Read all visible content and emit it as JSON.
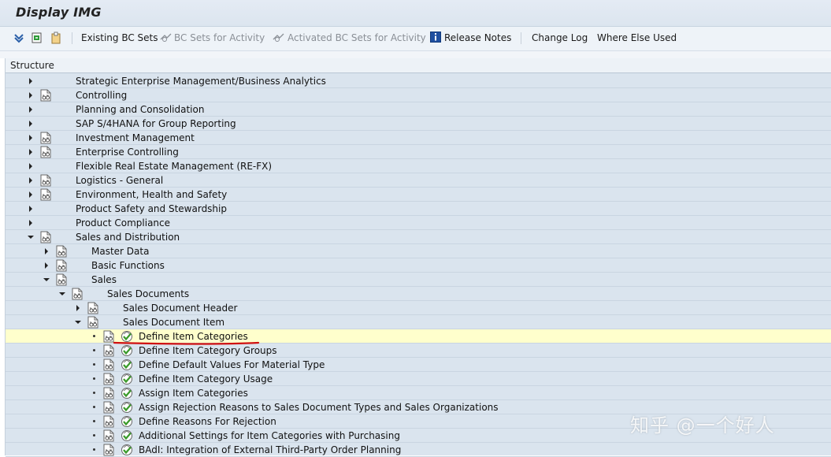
{
  "window": {
    "title": "Display IMG"
  },
  "toolbar": {
    "existing_bc_sets": "Existing BC Sets",
    "bc_sets_for_activity": "BC Sets for Activity",
    "activated_bc_sets": "Activated BC Sets for Activity",
    "release_notes": "Release Notes",
    "change_log": "Change Log",
    "where_else_used": "Where Else Used"
  },
  "tree": {
    "header": "Structure",
    "rows": [
      {
        "label": "Strategic Enterprise Management/Business Analytics",
        "level": 0,
        "state": "collapsed",
        "doc": false
      },
      {
        "label": "Controlling",
        "level": 0,
        "state": "collapsed",
        "doc": true
      },
      {
        "label": "Planning and Consolidation",
        "level": 0,
        "state": "collapsed",
        "doc": false
      },
      {
        "label": "SAP S/4HANA for Group Reporting",
        "level": 0,
        "state": "collapsed",
        "doc": false
      },
      {
        "label": "Investment Management",
        "level": 0,
        "state": "collapsed",
        "doc": true
      },
      {
        "label": "Enterprise Controlling",
        "level": 0,
        "state": "collapsed",
        "doc": true
      },
      {
        "label": "Flexible Real Estate Management (RE-FX)",
        "level": 0,
        "state": "collapsed",
        "doc": false
      },
      {
        "label": "Logistics - General",
        "level": 0,
        "state": "collapsed",
        "doc": true
      },
      {
        "label": "Environment, Health and Safety",
        "level": 0,
        "state": "collapsed",
        "doc": true
      },
      {
        "label": "Product Safety and Stewardship",
        "level": 0,
        "state": "collapsed",
        "doc": false
      },
      {
        "label": "Product Compliance",
        "level": 0,
        "state": "collapsed",
        "doc": false
      },
      {
        "label": "Sales and Distribution",
        "level": 0,
        "state": "expanded",
        "doc": true
      },
      {
        "label": "Master Data",
        "level": 1,
        "state": "collapsed",
        "doc": true
      },
      {
        "label": "Basic Functions",
        "level": 1,
        "state": "collapsed",
        "doc": true
      },
      {
        "label": "Sales",
        "level": 1,
        "state": "expanded",
        "doc": true
      },
      {
        "label": "Sales Documents",
        "level": 2,
        "state": "expanded",
        "doc": true
      },
      {
        "label": "Sales Document Header",
        "level": 3,
        "state": "collapsed",
        "doc": true
      },
      {
        "label": "Sales Document Item",
        "level": 3,
        "state": "expanded",
        "doc": true
      },
      {
        "label": "Define Item Categories",
        "level": 4,
        "state": "leaf",
        "doc": true,
        "highlight": true
      },
      {
        "label": "Define Item Category Groups",
        "level": 4,
        "state": "leaf",
        "doc": true
      },
      {
        "label": "Define Default Values For Material Type",
        "level": 4,
        "state": "leaf",
        "doc": true
      },
      {
        "label": "Define Item Category Usage",
        "level": 4,
        "state": "leaf",
        "doc": true
      },
      {
        "label": "Assign Item Categories",
        "level": 4,
        "state": "leaf",
        "doc": true
      },
      {
        "label": "Assign Rejection Reasons to Sales Document Types and Sales Organizations",
        "level": 4,
        "state": "leaf",
        "doc": true
      },
      {
        "label": "Define Reasons For Rejection",
        "level": 4,
        "state": "leaf",
        "doc": true
      },
      {
        "label": "Additional Settings for Item Categories with Purchasing",
        "level": 4,
        "state": "leaf",
        "doc": true
      },
      {
        "label": "BAdI: Integration of External Third-Party Order Planning",
        "level": 4,
        "state": "leaf",
        "doc": true
      }
    ]
  },
  "watermark": "知乎 @一个好人",
  "colors": {
    "highlight": "#ffffcc",
    "tree_bg": "#dae4ee",
    "annotation": "#d01010",
    "exec_icon": "#3a9a2a"
  }
}
